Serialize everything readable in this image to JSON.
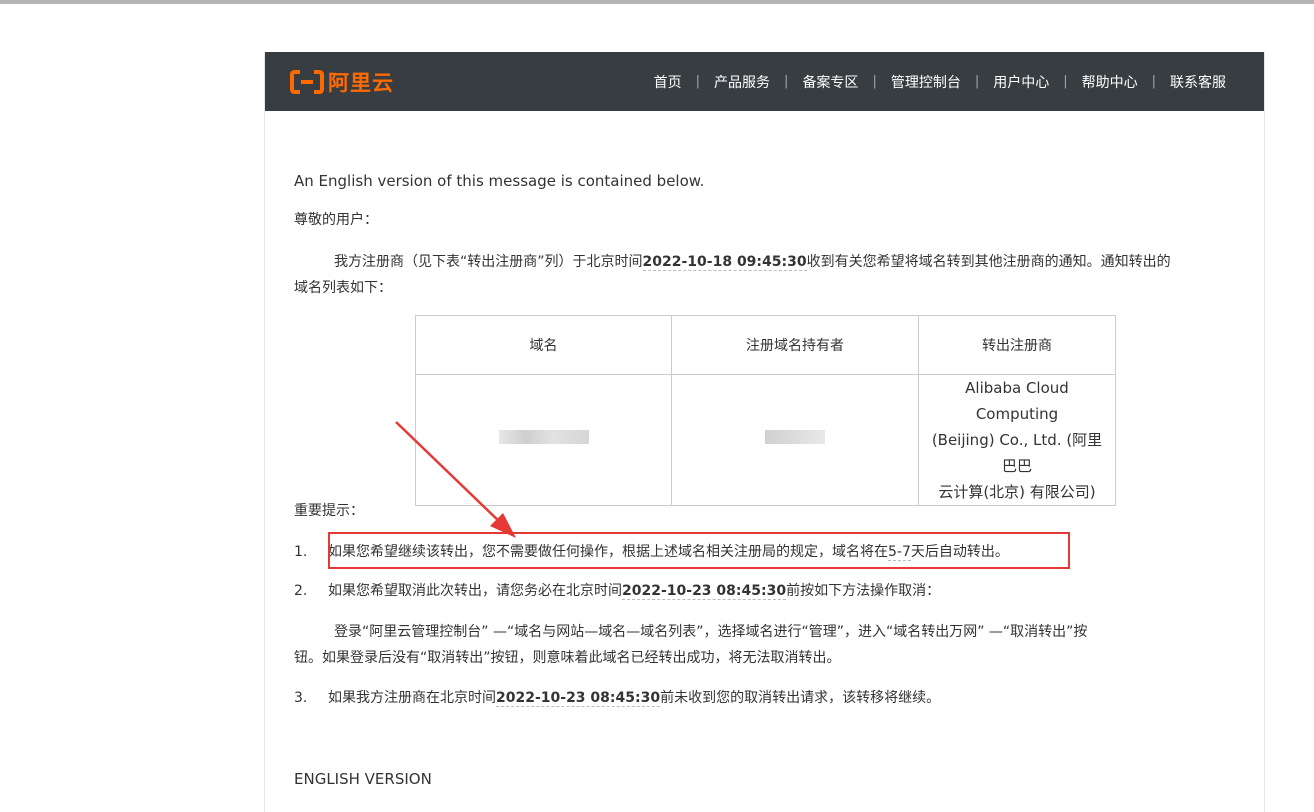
{
  "header": {
    "logo_text": "阿里云",
    "nav": [
      "首页",
      "产品服务",
      "备案专区",
      "管理控制台",
      "用户中心",
      "帮助中心",
      "联系客服"
    ],
    "separator": "|"
  },
  "body": {
    "english_note": "An English version of this message is contained below.",
    "greeting": "尊敬的用户：",
    "intro_before": "我方注册商（见下表“转出注册商”列）于北京时间",
    "intro_time": "2022-10-18 09:45:30",
    "intro_after": "收到有关您希望将域名转到其他注册商的通知。通知转出的",
    "intro_line2": "域名列表如下：",
    "table": {
      "headers": [
        "域名",
        "注册域名持有者",
        "转出注册商"
      ],
      "registrar_line1": "Alibaba Cloud Computing",
      "registrar_line2": "(Beijing) Co., Ltd. (阿里巴巴",
      "registrar_line3": "云计算(北京) 有限公司)"
    },
    "important": "重要提示：",
    "item1_num": "1.",
    "item1_before": "如果您希望继续该转出，您不需要做任何操作，根据上述域名相关注册局的规定，域名将在",
    "item1_days": "5-7",
    "item1_after": "天后自动转出。",
    "item2_num": "2.",
    "item2_before": "如果您希望取消此次转出，请您务必在北京时间",
    "item2_time": "2022-10-23 08:45:30",
    "item2_after": "前按如下方法操作取消：",
    "cancel_line1": "登录“阿里云管理控制台” —“域名与网站—域名—域名列表”，选择域名进行“管理”，进入“域名转出万网” —“取消转出”按",
    "cancel_line2": "钮。如果登录后没有“取消转出”按钮，则意味着此域名已经转出成功，将无法取消转出。",
    "item3_num": "3.",
    "item3_before": "如果我方注册商在北京时间",
    "item3_time": "2022-10-23 08:45:30",
    "item3_after": "前未收到您的取消转出请求，该转移将继续。",
    "english_heading": "ENGLISH VERSION"
  },
  "colors": {
    "header_bg": "#373d41",
    "logo_orange": "#ff6a00",
    "annotation_red": "#e53935"
  }
}
